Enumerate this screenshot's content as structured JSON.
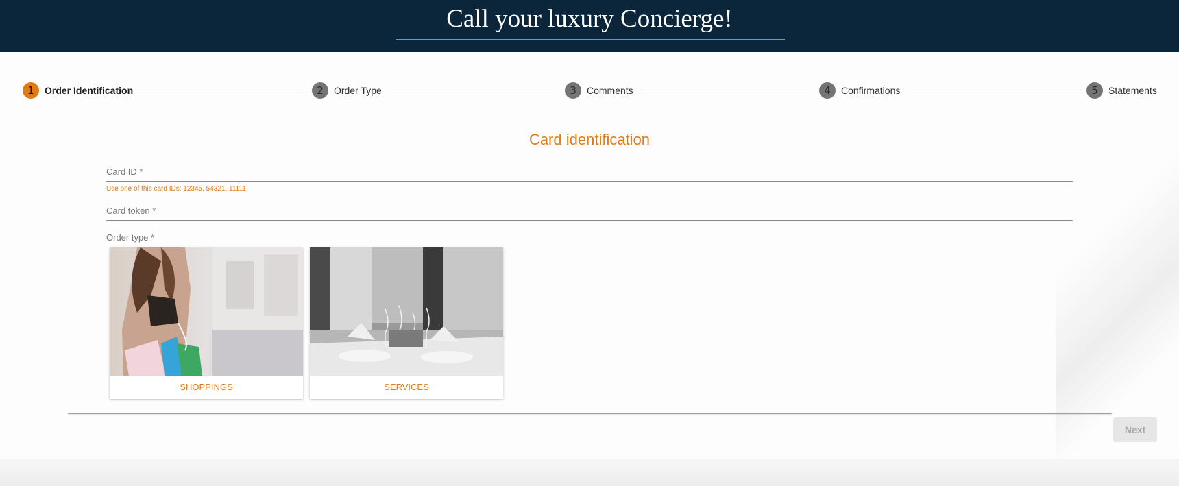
{
  "header": {
    "title": "Call your luxury Concierge!"
  },
  "stepper": {
    "steps": [
      {
        "number": "1",
        "label": "Order Identification"
      },
      {
        "number": "2",
        "label": "Order Type"
      },
      {
        "number": "3",
        "label": "Comments"
      },
      {
        "number": "4",
        "label": "Confirmations"
      },
      {
        "number": "5",
        "label": "Statements"
      }
    ],
    "active_step": 1
  },
  "form": {
    "title": "Card identification",
    "card_id": {
      "label": "Card ID *",
      "value": "",
      "hint": "Use one of this card IDs: 12345, 54321, 11111"
    },
    "card_token": {
      "label": "Card token *",
      "value": ""
    },
    "order_type": {
      "label": "Order type *",
      "options": [
        {
          "label": "SHOPPINGS"
        },
        {
          "label": "SERVICES"
        }
      ]
    }
  },
  "actions": {
    "next_label": "Next",
    "next_disabled": true
  },
  "colors": {
    "accent": "#e07b1a",
    "header_bg": "#0b253a",
    "step_inactive": "#757575"
  }
}
